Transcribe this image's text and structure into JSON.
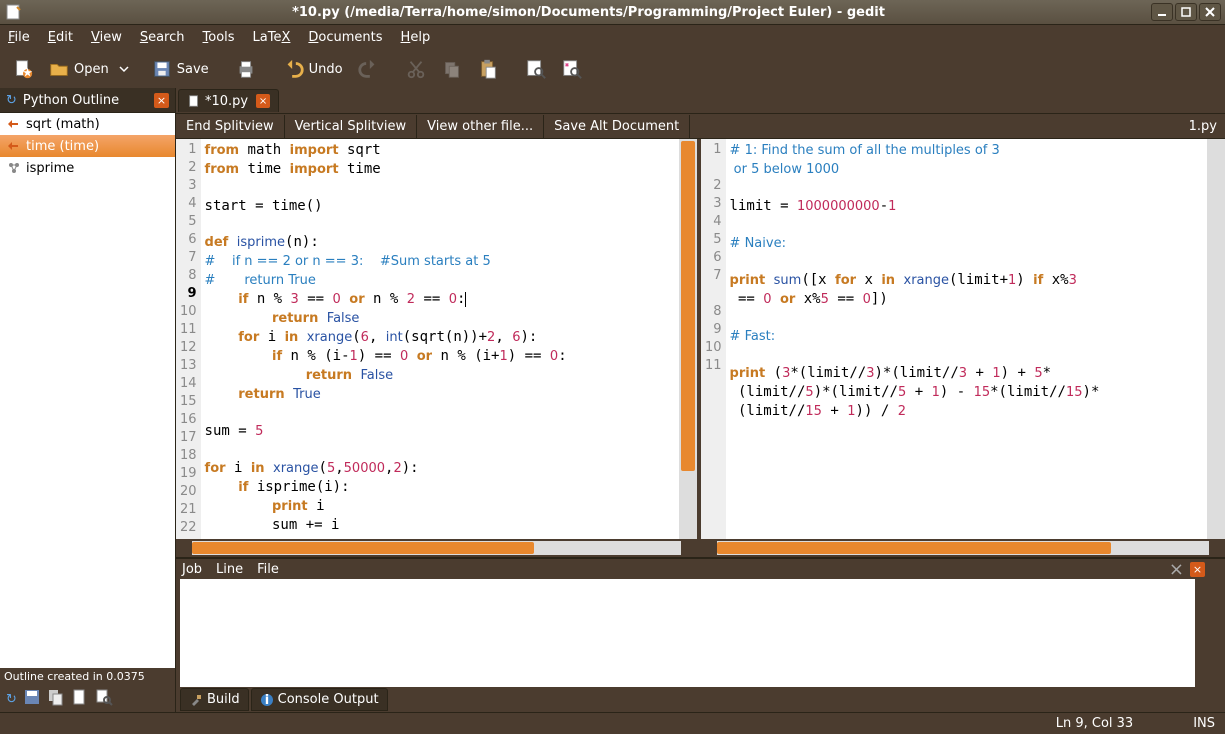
{
  "title": "*10.py (/media/Terra/home/simon/Documents/Programming/Project Euler) - gedit",
  "menus": [
    "File",
    "Edit",
    "View",
    "Search",
    "Tools",
    "LaTeX",
    "Documents",
    "Help"
  ],
  "toolbar": {
    "open": "Open",
    "save": "Save",
    "undo": "Undo"
  },
  "sidebar": {
    "tab": "Python Outline",
    "items": [
      {
        "label": "sqrt (math)",
        "icon": "fn"
      },
      {
        "label": "time (time)",
        "icon": "fn",
        "selected": true
      },
      {
        "label": "isprime",
        "icon": "class"
      }
    ],
    "status": "Outline created in 0.0375"
  },
  "doctab": {
    "label": "*10.py"
  },
  "split": {
    "end": "End Splitview",
    "vert": "Vertical Splitview",
    "other": "View other file...",
    "savealt": "Save Alt Document",
    "right": "1.py"
  },
  "bottom": {
    "cols": [
      "Job",
      "Line",
      "File"
    ],
    "tabs": [
      "Build",
      "Console Output"
    ]
  },
  "status": {
    "pos": "Ln 9, Col 33",
    "ins": "INS"
  },
  "left_lines": 22,
  "right_lines": 11
}
